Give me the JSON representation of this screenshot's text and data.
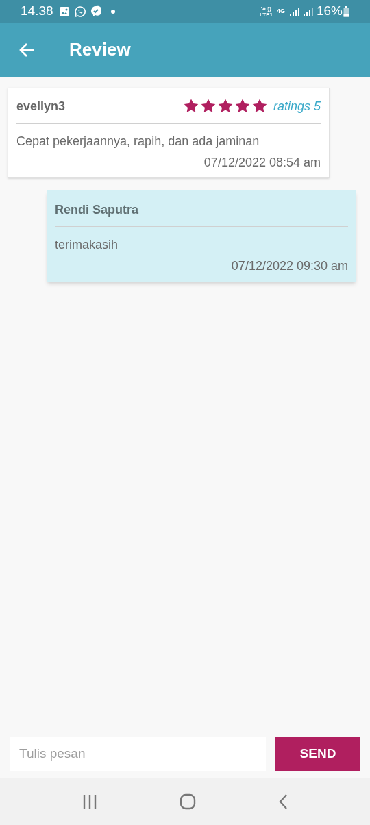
{
  "status_bar": {
    "time": "14.38",
    "network_top": "Vo))",
    "network_bottom": "LTE1",
    "data_type": "4G",
    "battery": "16%"
  },
  "app_bar": {
    "title": "Review"
  },
  "messages": [
    {
      "kind": "review",
      "author": "evellyn3",
      "stars": 5,
      "rating_label": "ratings 5",
      "text": "Cepat pekerjaannya, rapih, dan ada jaminan",
      "timestamp": "07/12/2022 08:54 am"
    },
    {
      "kind": "reply",
      "author": "Rendi Saputra",
      "text": "terimakasih",
      "timestamp": "07/12/2022 09:30 am"
    }
  ],
  "composer": {
    "placeholder": "Tulis pesan",
    "send_label": "SEND"
  }
}
